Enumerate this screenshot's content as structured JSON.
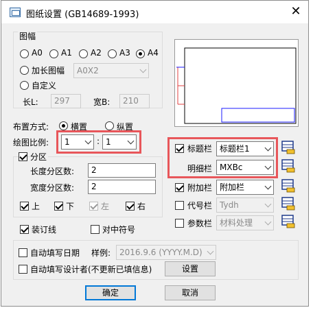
{
  "window": {
    "title": "图纸设置 (GB14689-1993)",
    "close_glyph": "✕"
  },
  "sheet_size": {
    "group_label": "图幅",
    "options": [
      "A0",
      "A1",
      "A2",
      "A3",
      "A4"
    ],
    "selected": "A4",
    "extended_label": "加长图幅",
    "extended_value": "A0X2",
    "custom_label": "自定义",
    "length_label": "长L:",
    "length_value": "297",
    "width_label": "宽B:",
    "width_value": "210"
  },
  "layout": {
    "label": "布置方式:",
    "landscape": "横置",
    "portrait": "纵置",
    "selected": "横置"
  },
  "scale": {
    "label": "绘图比例:",
    "left_value": "1",
    "separator": ":",
    "right_value": "1"
  },
  "zones": {
    "label": "分区",
    "checked": true,
    "h_count_label": "长度分区数:",
    "h_count_value": "2",
    "v_count_label": "宽度分区数:",
    "v_count_value": "2",
    "top": "上",
    "bottom": "下",
    "left": "左",
    "right": "右"
  },
  "binding_line": {
    "label": "装订线",
    "checked": true
  },
  "center_mark": {
    "label": "对中符号",
    "checked": false
  },
  "title_block": {
    "label": "标题栏",
    "checked": true,
    "value": "标题栏1"
  },
  "detail_block": {
    "label": "明细栏",
    "value": "MXBc"
  },
  "extra_block": {
    "label": "附加栏",
    "checked": true,
    "value": "附加栏"
  },
  "code_block": {
    "label": "代号栏",
    "checked": false,
    "value": "Tydh"
  },
  "param_block": {
    "label": "参数栏",
    "checked": false,
    "value": "材料处理"
  },
  "auto_date": {
    "label": "自动填写日期",
    "checked": false,
    "sample_label": "样例:",
    "sample_value": "2016.9.6 (YYYY.M.D)"
  },
  "auto_designer": {
    "label": "自动填写设计者(不更新已填信息)",
    "checked": false,
    "settings_label": "设置"
  },
  "buttons": {
    "ok": "确定",
    "cancel": "取消"
  },
  "icons": {
    "edit_title_block": "table-edit-icon",
    "edit_detail_block": "table-edit-icon",
    "edit_extra_block": "table-edit-icon",
    "edit_code_block": "table-edit-icon",
    "edit_param_block": "table-edit-icon"
  },
  "colors": {
    "highlight": "#e8565a",
    "preview_frame": "#000000",
    "preview_title": "#1a1aff",
    "preview_margin": "#e04040"
  }
}
